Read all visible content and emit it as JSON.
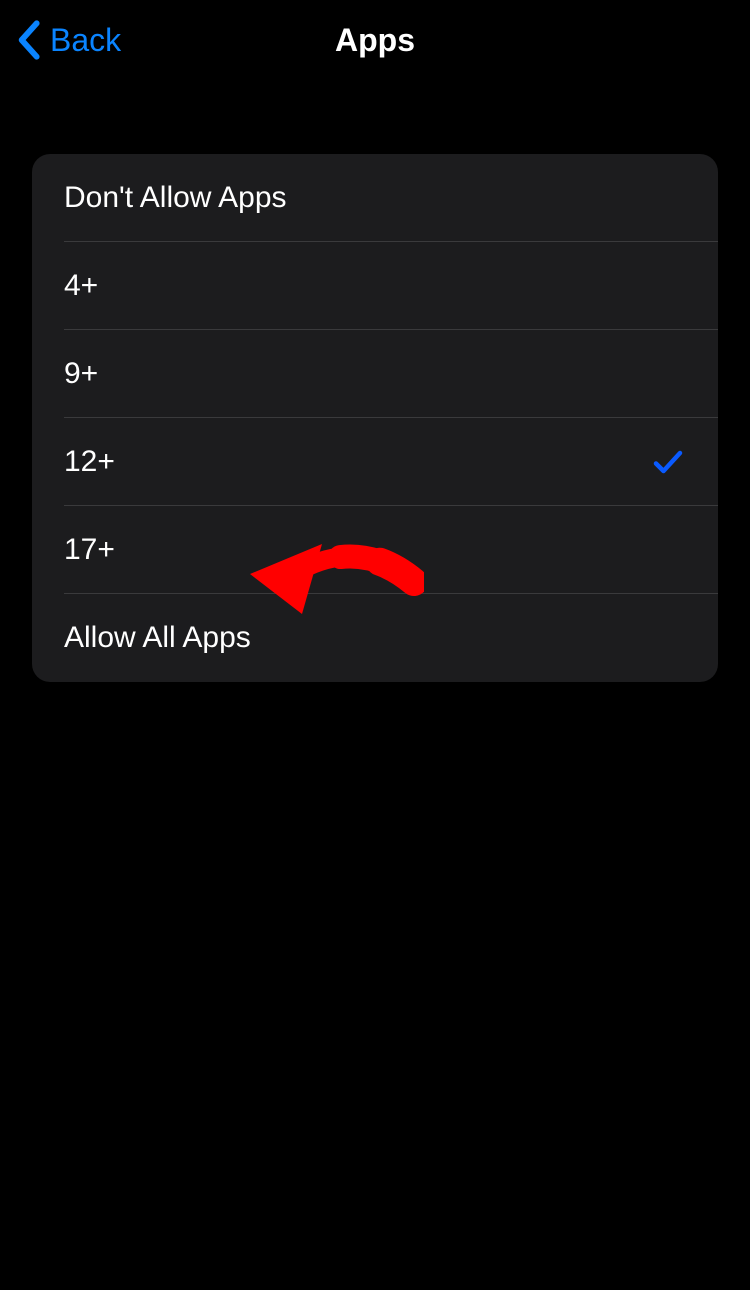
{
  "header": {
    "back_label": "Back",
    "title": "Apps"
  },
  "options": [
    {
      "label": "Don't Allow Apps",
      "selected": false
    },
    {
      "label": "4+",
      "selected": false
    },
    {
      "label": "9+",
      "selected": false
    },
    {
      "label": "12+",
      "selected": true
    },
    {
      "label": "17+",
      "selected": false
    },
    {
      "label": "Allow All Apps",
      "selected": false
    }
  ],
  "colors": {
    "link": "#0a84ff",
    "check": "#0a5aff",
    "annotation": "#ff0000"
  }
}
